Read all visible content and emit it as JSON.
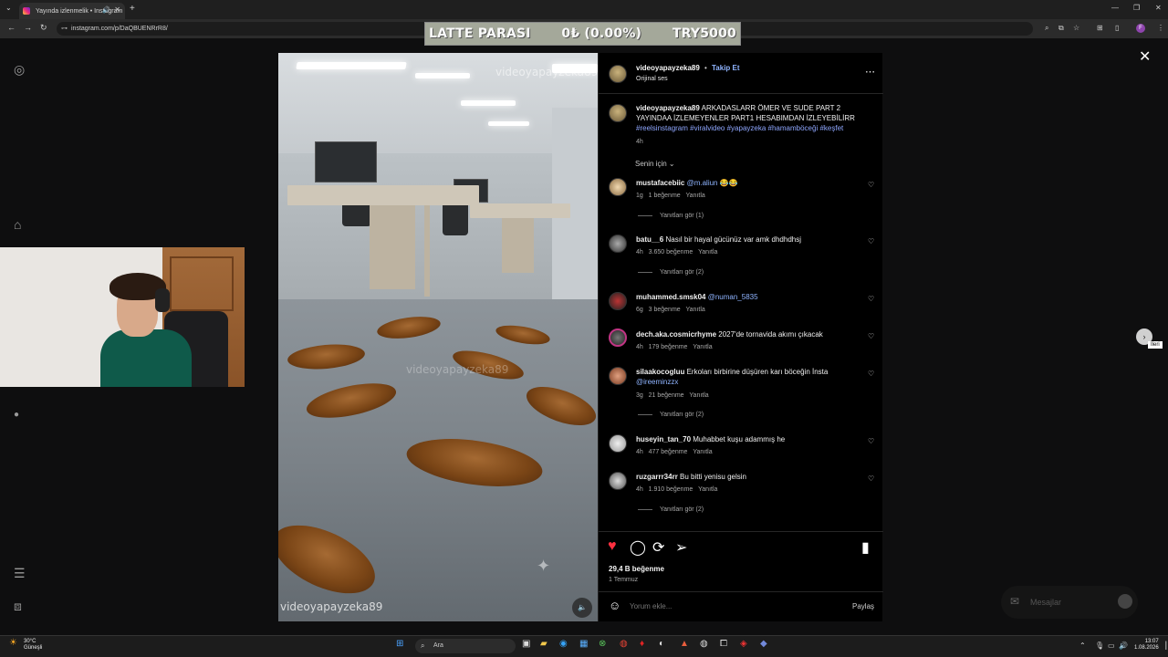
{
  "browser": {
    "tab_title": "Yayında izlenmelik • Instagram",
    "new_tab": "+",
    "url": "instagram.com/p/DaQBUENRrR8/"
  },
  "overlay": {
    "left": "LATTE PARASI",
    "middle": "0₺ (0.00%)",
    "right": "TRY5000"
  },
  "video": {
    "watermark_top": "videoyapayzeka89",
    "watermark_mid": "videoyapayzeka89",
    "watermark_bottom": "videoyapayzeka89"
  },
  "post": {
    "author": "videoyapayzeka89",
    "follow_label": "Takip Et",
    "audio": "Orijinal ses",
    "caption_user": "videoyapayzeka89",
    "caption_text": "ARKADASLARR ÖMER VE SUDE PART 2 YAYINDAA İZLEMEYENLER PART1 HESABIMDAN İZLEYEBİLİRR",
    "caption_tags": "#reelsinstagram #viralvideo #yapayzeka #hamamböceği #keşfet",
    "caption_time": "4h",
    "sort_label": "Senin için",
    "comments": [
      {
        "user": "mustafacebiic",
        "text": "",
        "mention": "@m.aliun",
        "emoji": "😂😂",
        "time": "1g",
        "likes": "1 beğenme",
        "reply": "Yanıtla",
        "view_replies": "Yanıtları gör (1)"
      },
      {
        "user": "batu__6",
        "text": "Nasıl bir hayal gücünüz var amk dhdhdhsj",
        "mention": "",
        "emoji": "",
        "time": "4h",
        "likes": "3.650 beğenme",
        "reply": "Yanıtla",
        "view_replies": "Yanıtları gör (2)"
      },
      {
        "user": "muhammed.smsk04",
        "text": "",
        "mention": "@numan_5835",
        "emoji": "",
        "time": "6g",
        "likes": "3 beğenme",
        "reply": "Yanıtla",
        "view_replies": ""
      },
      {
        "user": "dech.aka.cosmicrhyme",
        "text": "2027'de tornavida akımı çıkacak",
        "mention": "",
        "emoji": "",
        "time": "4h",
        "likes": "179 beğenme",
        "reply": "Yanıtla",
        "view_replies": ""
      },
      {
        "user": "silaakocogluu",
        "text": "Erkoları birbirine düşüren karı böceğin İnsta",
        "mention": "@ireeminzzx",
        "emoji": "",
        "time": "3g",
        "likes": "21 beğenme",
        "reply": "Yanıtla",
        "view_replies": "Yanıtları gör (2)"
      },
      {
        "user": "huseyin_tan_70",
        "text": "Muhabbet kuşu adammış he",
        "mention": "",
        "emoji": "",
        "time": "4h",
        "likes": "477 beğenme",
        "reply": "Yanıtla",
        "view_replies": ""
      },
      {
        "user": "ruzgarrr34rr",
        "text": "Bu bitti yenisu gelsin",
        "mention": "",
        "emoji": "",
        "time": "4h",
        "likes": "1.910 beğenme",
        "reply": "Yanıtla",
        "view_replies": "Yanıtları gör (2)"
      }
    ],
    "likes_total": "29,4 B beğenme",
    "date": "1 Temmuz",
    "comment_placeholder": "Yorum ekle...",
    "share_label": "Paylaş"
  },
  "side": {
    "next_tooltip": "İleri",
    "messages_label": "Mesajlar"
  },
  "taskbar": {
    "temp": "30°C",
    "weather": "Güneşli",
    "search": "Ara",
    "time": "13:07",
    "date": "1.08.2026"
  }
}
